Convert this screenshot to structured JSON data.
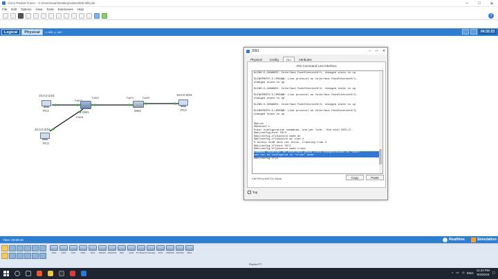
{
  "app": {
    "title": "Cisco Packet Tracer - C:\\Users\\user\\Desktop\\video\\000.000.pkt",
    "menu": [
      "File",
      "Edit",
      "Options",
      "View",
      "Tools",
      "Extensions",
      "Help"
    ]
  },
  "modebar": {
    "logical_label": "Logical",
    "physical_label": "Physical",
    "coords": "x: 808, y: 480",
    "clock": "04:32:23"
  },
  "topology": {
    "pc1": {
      "ip": "10.0.0.1/24",
      "name": "PC1"
    },
    "pc2": {
      "ip": "10.0.0.2/24",
      "name": "PC2"
    },
    "pc3": {
      "ip": "10.0.0.3/24",
      "name": "PC3"
    },
    "sw1": {
      "name": "SW1"
    },
    "sw2": {
      "name": "SW2"
    },
    "ports": {
      "fa0_2": "Fa0/2",
      "fa0_1a": "Fa0/1",
      "fa0_1b": "Fa0/1",
      "fa0_3": "Fa0/3",
      "fa0_5": "Fa0/5"
    }
  },
  "dialog": {
    "title": "SW1",
    "tabs": [
      "Physical",
      "Config",
      "CLI",
      "Attributes"
    ],
    "active_tab": "CLI",
    "panel_title": "IOS Command Line Interface",
    "console_lines": [
      "%LINK-5-CHANGED: Interface FastEthernet0/1, changed state to up",
      "",
      "%LINEPROTO-5-UPDOWN: Line protocol on Interface FastEthernet0/1,",
      "changed state to up",
      "",
      "%LINK-5-CHANGED: Interface FastEthernet0/2, changed state to up",
      "",
      "%LINEPROTO-5-UPDOWN: Line protocol on Interface FastEthernet0/2,",
      "changed state to up",
      "",
      "%LINK-5-CHANGED: Interface FastEthernet0/3, changed state to up",
      "",
      "%LINEPROTO-5-UPDOWN: Line protocol on Interface FastEthernet0/3,",
      "changed state to up",
      "",
      "",
      "SW1>en",
      "SW1#conf t",
      "Enter configuration commands, one per line.  End with CNTL/Z.",
      "SW1(config)#int f0/3",
      "SW1(config-if)#switch mode ac",
      "SW1(config-if)#switch ac vlan 2",
      "% Access VLAN does not exist. Creating vlan 2",
      "SW1(config-if)#int f0/1",
      "SW1(config-if)#switch mode trunk"
    ],
    "console_highlight": [
      "Command rejected: An interface whose trunk encapsulation is \"Auto\"",
      "can not be configured to \"trunk\" mode."
    ],
    "prompt": "SW1(config-if)#",
    "hint": "Ctrl+F6 to exit CLI focus",
    "copy_label": "Copy",
    "paste_label": "Paste",
    "top_label": "Top"
  },
  "bottom": {
    "time": "Time: 00:08:34",
    "realtime_label": "Realtime",
    "simulation_label": "Simulation",
    "device_labels": [
      "4331",
      "4321",
      "1941",
      "2901",
      "2911",
      "819IOX",
      "819HGW",
      "829",
      "1240",
      "PT-Router",
      "PT-Empty",
      "1841",
      "2620XM",
      "2621XM",
      "2811"
    ],
    "selected_device": "Router-PT"
  },
  "taskbar": {
    "lang": "ENG",
    "time": "11:24 PM",
    "date": "5/3/2019"
  },
  "colors": {
    "accent": "#2f7dcf",
    "link_green": "#2fae3f",
    "highlight": "#3278d2"
  }
}
